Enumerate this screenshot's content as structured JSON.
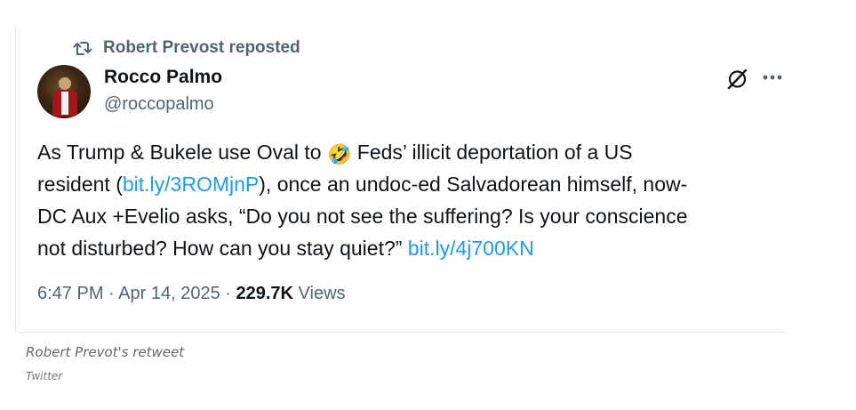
{
  "repost": {
    "icon": "repost-icon",
    "text": "Robert Prevost reposted"
  },
  "author": {
    "avatar": "avatar",
    "name": "Rocco Palmo",
    "handle": "@roccopalmo"
  },
  "actions": {
    "grok_icon": "grok-icon",
    "more_icon": "more-icon"
  },
  "tweet": {
    "line1_a": "As Trump & Bukele use Oval to ",
    "emoji": "🤣",
    "line1_b": " Feds’ illicit deportation of a US",
    "line2_a": "resident (",
    "link1": "bit.ly/3ROMjnP",
    "line2_b": "), once an undoc-ed Salvadorean himself, now-",
    "line3": "DC Aux +Evelio asks, “Do you not see the suffering? Is your conscience",
    "line4_a": "not disturbed? How can you stay quiet?” ",
    "link2": "bit.ly/4j700KN"
  },
  "meta": {
    "time": "6:47 PM",
    "sep1": " · ",
    "date": "Apr 14, 2025",
    "sep2": " · ",
    "views_count": "229.7K",
    "views_label": " Views"
  },
  "caption": {
    "text": "Robert Prevot's retweet",
    "credit": "Twitter"
  },
  "colors": {
    "link": "#1d9bf0",
    "secondary_text": "#536471",
    "primary_text": "#0f1419"
  }
}
